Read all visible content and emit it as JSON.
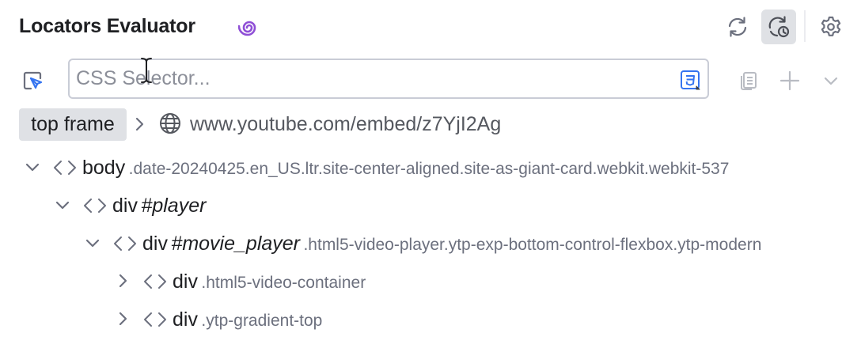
{
  "header": {
    "title": "Locators Evaluator"
  },
  "search": {
    "placeholder": "CSS Selector...",
    "value": ""
  },
  "breadcrumb": {
    "frame": "top frame",
    "url": "www.youtube.com/embed/z7YjI2Ag"
  },
  "tree": [
    {
      "tag": "body",
      "id": "",
      "classes": ".date-20240425.en_US.ltr.site-center-aligned.site-as-giant-card.webkit.webkit-537",
      "expanded": true
    },
    {
      "tag": "div",
      "id": "#player",
      "classes": "",
      "expanded": true
    },
    {
      "tag": "div",
      "id": "#movie_player",
      "classes": ".html5-video-player.ytp-exp-bottom-control-flexbox.ytp-modern",
      "expanded": true
    },
    {
      "tag": "div",
      "id": "",
      "classes": ".html5-video-container",
      "expanded": false
    },
    {
      "tag": "div",
      "id": "",
      "classes": ".ytp-gradient-top",
      "expanded": false
    }
  ],
  "colors": {
    "accent_purple": "#8f4fd6",
    "icon_blue": "#3574f0",
    "icon_gray": "#6c707e",
    "muted_text": "#6c707e"
  },
  "icons": {
    "logo": "spiral-logo-icon",
    "refresh": "sync-icon",
    "history": "history-reload-icon",
    "settings": "gear-icon",
    "pick": "pick-element-icon",
    "css": "css-file-icon",
    "copy": "copy-icon",
    "add": "plus-icon",
    "more": "chevron-down-icon"
  }
}
